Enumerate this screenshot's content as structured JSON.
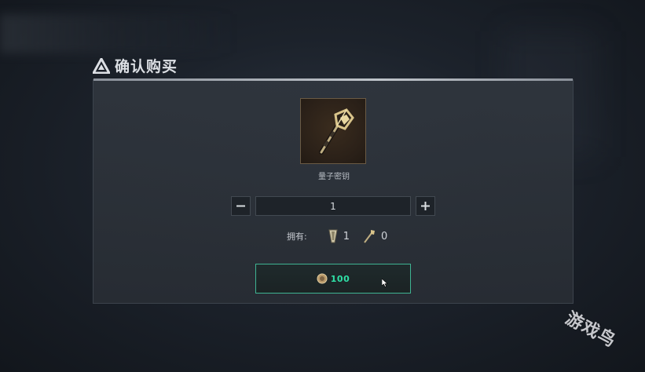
{
  "dialog": {
    "title": "确认购买",
    "item_name": "量子密钥",
    "quantity": {
      "value": "1",
      "minus_icon": "minus-icon",
      "plus_icon": "plus-icon"
    },
    "owned": {
      "label": "拥有:",
      "items": [
        {
          "icon": "quantum-shard-icon",
          "count": "1"
        },
        {
          "icon": "quantum-key-icon",
          "count": "0"
        }
      ]
    },
    "buy_button": {
      "price": "100",
      "currency_icon": "coin-icon"
    }
  },
  "watermark": "游戏鸟",
  "colors": {
    "accent": "#2fe0a6",
    "button_border": "#3fb392",
    "dialog_bg": "#2f353d",
    "item_frame_border": "#6a5a44"
  }
}
